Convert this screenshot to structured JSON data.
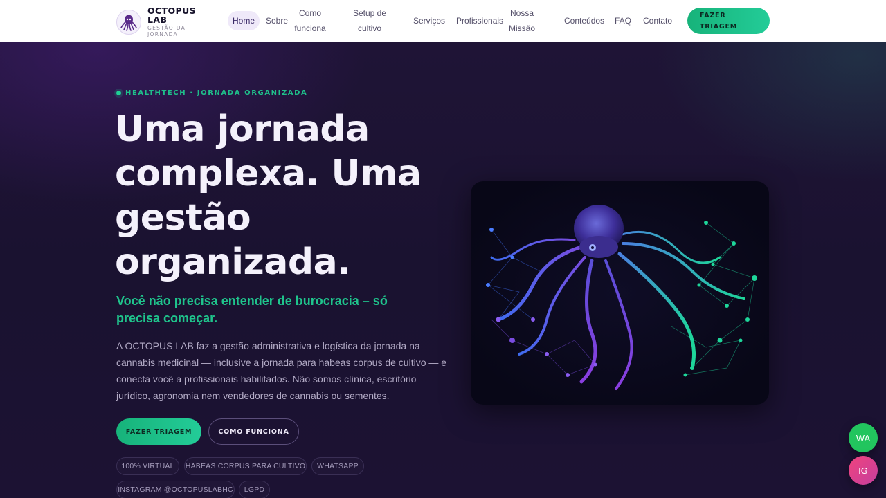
{
  "brand": {
    "name": "OCTOPUS LAB",
    "tagline": "GESTÃO DA JORNADA"
  },
  "nav": {
    "items": [
      {
        "label": "Home",
        "active": true
      },
      {
        "label": "Sobre"
      },
      {
        "label": "Como funciona"
      },
      {
        "label": "Setup de cultivo"
      },
      {
        "label": "Serviços"
      },
      {
        "label": "Profissionais"
      },
      {
        "label": "Nossa Missão"
      },
      {
        "label": "Conteúdos"
      },
      {
        "label": "FAQ"
      },
      {
        "label": "Contato"
      }
    ],
    "cta": "FAZER TRIAGEM"
  },
  "hero": {
    "eyebrow": "HEALTHTECH · JORNADA ORGANIZADA",
    "title": "Uma jornada complexa. Uma gestão organizada.",
    "subtitle": "Você não precisa entender de burocracia – só precisa começar.",
    "body": "A OCTOPUS LAB faz a gestão administrativa e logística da jornada na cannabis medicinal — inclusive a jornada para habeas corpus de cultivo — e conecta você a profissionais habilitados. Não somos clínica, escritório jurídico, agronomia nem vendedores de cannabis ou sementes.",
    "primary_button": "FAZER TRIAGEM",
    "secondary_button": "COMO FUNCIONA",
    "chips": [
      "100% VIRTUAL",
      "HABEAS CORPUS PARA CULTIVO",
      "WHATSAPP",
      "INSTAGRAM @OCTOPUSLABHC",
      "LGPD"
    ]
  },
  "floating": {
    "whatsapp": "WA",
    "instagram": "IG"
  },
  "icons": {
    "logo": "octopus-icon",
    "art": "octopus-network-illustration"
  },
  "colors": {
    "accent": "#1fc48c",
    "background": "#1a1230",
    "purple": "#6d3fd6"
  }
}
